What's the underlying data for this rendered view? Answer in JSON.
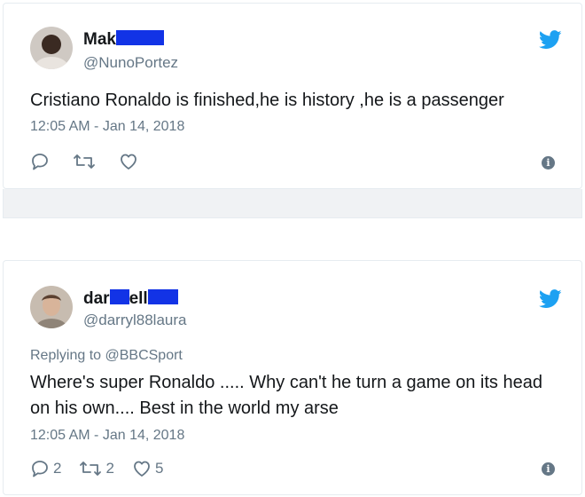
{
  "tweets": [
    {
      "name_visible": "Mak",
      "handle": "@NunoPortez",
      "text": "Cristiano Ronaldo is finished,he is history ,he is a passenger",
      "timestamp": "12:05 AM - Jan 14, 2018",
      "reply_count": "",
      "retweet_count": "",
      "like_count": ""
    },
    {
      "name_part1": "dar",
      "name_part2": "ell",
      "handle": "@darryl88laura",
      "replying_to": "Replying to @BBCSport",
      "text": "Where's super Ronaldo ..... Why can't he turn a game on its head on his own.... Best in the world my arse",
      "timestamp": "12:05 AM - Jan 14, 2018",
      "reply_count": "2",
      "retweet_count": "2",
      "like_count": "5"
    }
  ],
  "icons": {
    "brand": "twitter-bird-icon",
    "reply": "reply-icon",
    "retweet": "retweet-icon",
    "like": "heart-icon",
    "info": "info-icon"
  },
  "colors": {
    "twitter_blue": "#1da1f2",
    "redaction": "#1233e6",
    "secondary_text": "#657786"
  }
}
